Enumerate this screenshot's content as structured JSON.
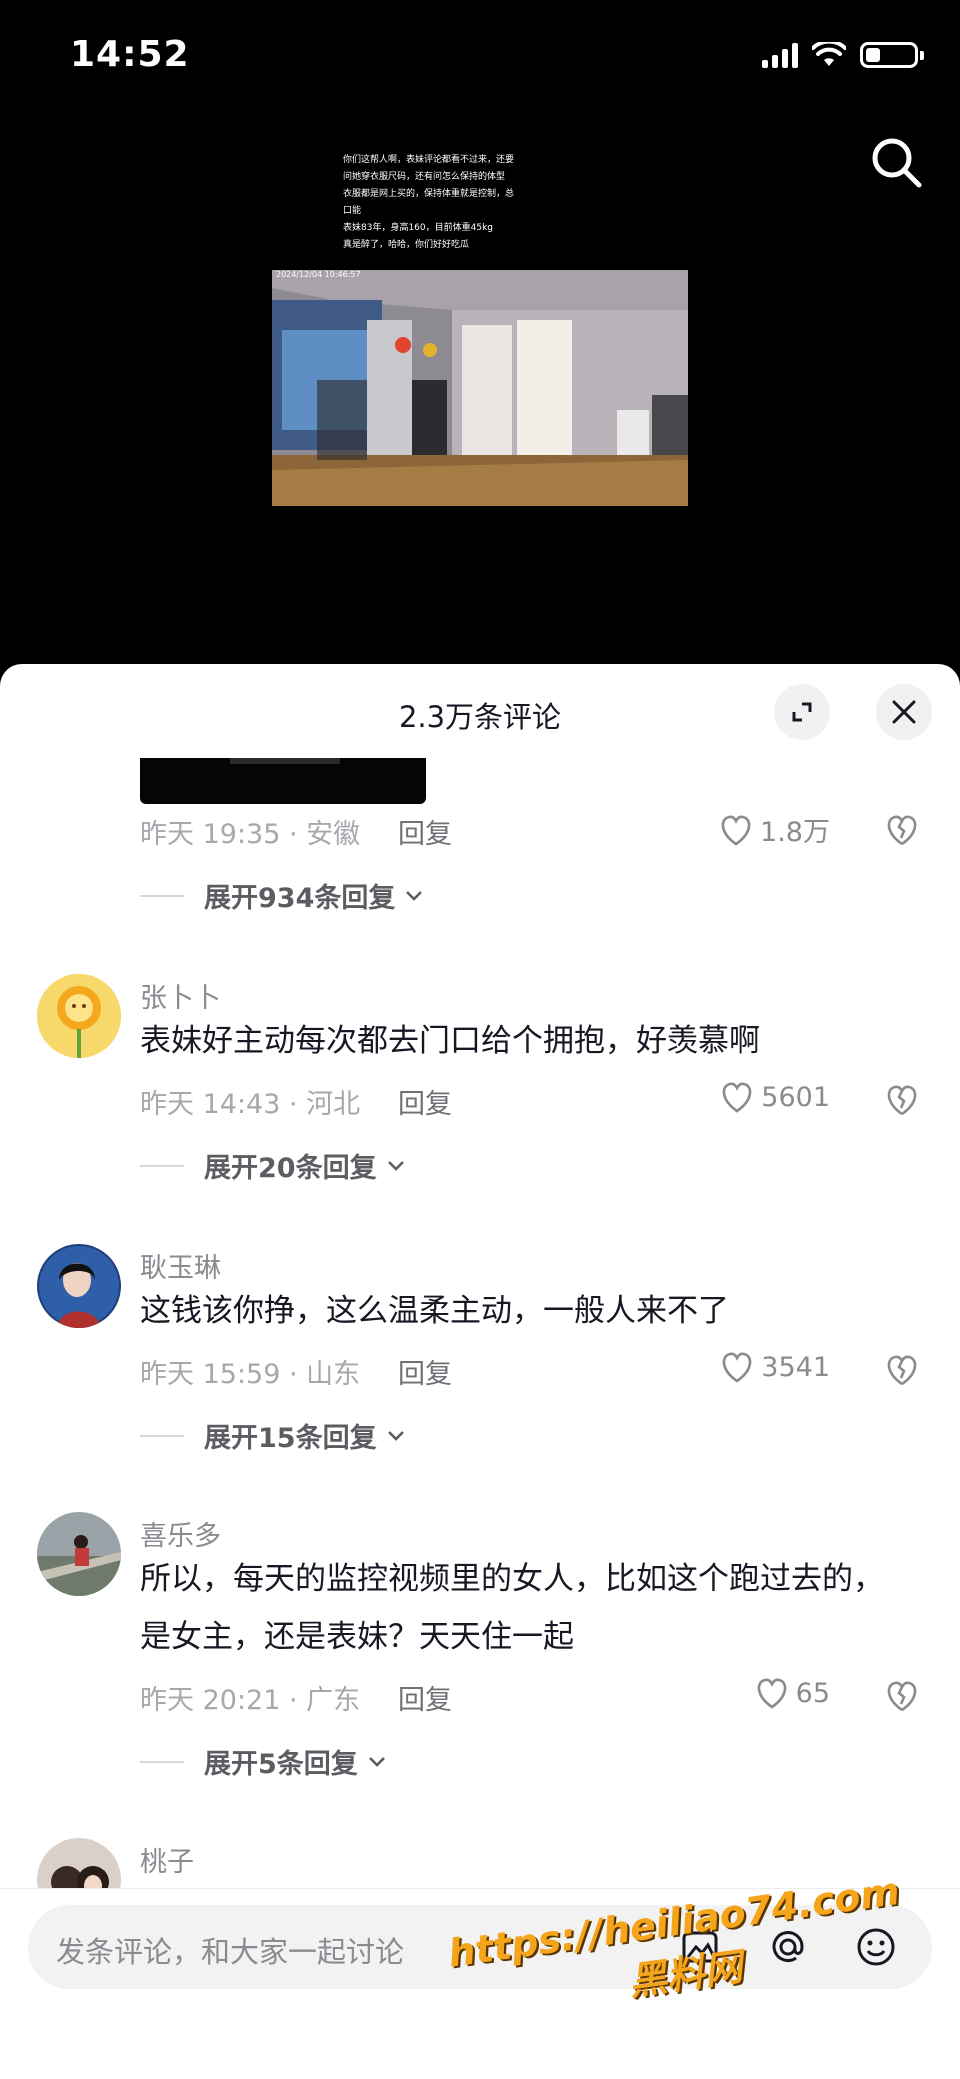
{
  "status_bar": {
    "time": "14:52"
  },
  "video": {
    "caption_lines": [
      "你们这帮人啊，表妹评论都看不过来，还要",
      "问她穿衣服尺码，还有问怎么保持的体型",
      "衣服都是网上买的，保持体重就是控制，总",
      "口能",
      "表妹83年，身高160，目前体重45kg",
      "真是醉了，哈哈，你们好好吃瓜"
    ],
    "timestamp": "2024/12/04 10:46:57"
  },
  "comments_sheet": {
    "title": "2.3万条评论",
    "first_comment": {
      "meta": "昨天 19:35 · 安徽",
      "reply": "回复",
      "likes": "1.8万",
      "expand": "展开934条回复"
    },
    "comments": [
      {
        "username": "张卜卜",
        "text": "表妹好主动每次都去门口给个拥抱，好羡慕啊",
        "meta": "昨天 14:43 · 河北",
        "reply": "回复",
        "likes": "5601",
        "expand": "展开20条回复"
      },
      {
        "username": "耿玉琳",
        "text": "这钱该你挣，这么温柔主动，一般人来不了",
        "meta": "昨天 15:59 · 山东",
        "reply": "回复",
        "likes": "3541",
        "expand": "展开15条回复"
      },
      {
        "username": "喜乐多",
        "text": "所以，每天的监控视频里的女人，比如这个跑过去的，是女主，还是表妹？天天住一起",
        "meta": "昨天 20:21 · 广东",
        "reply": "回复",
        "likes": "65",
        "expand": "展开5条回复"
      },
      {
        "username": "桃子"
      }
    ]
  },
  "input_bar": {
    "placeholder": "发条评论，和大家一起讨论"
  },
  "watermark": {
    "url": "https://heiliao74.com",
    "name": "黑料网"
  },
  "colors": {
    "accent_bg": "#000000",
    "sheet_bg": "#ffffff",
    "watermark": "#f4a51c"
  }
}
